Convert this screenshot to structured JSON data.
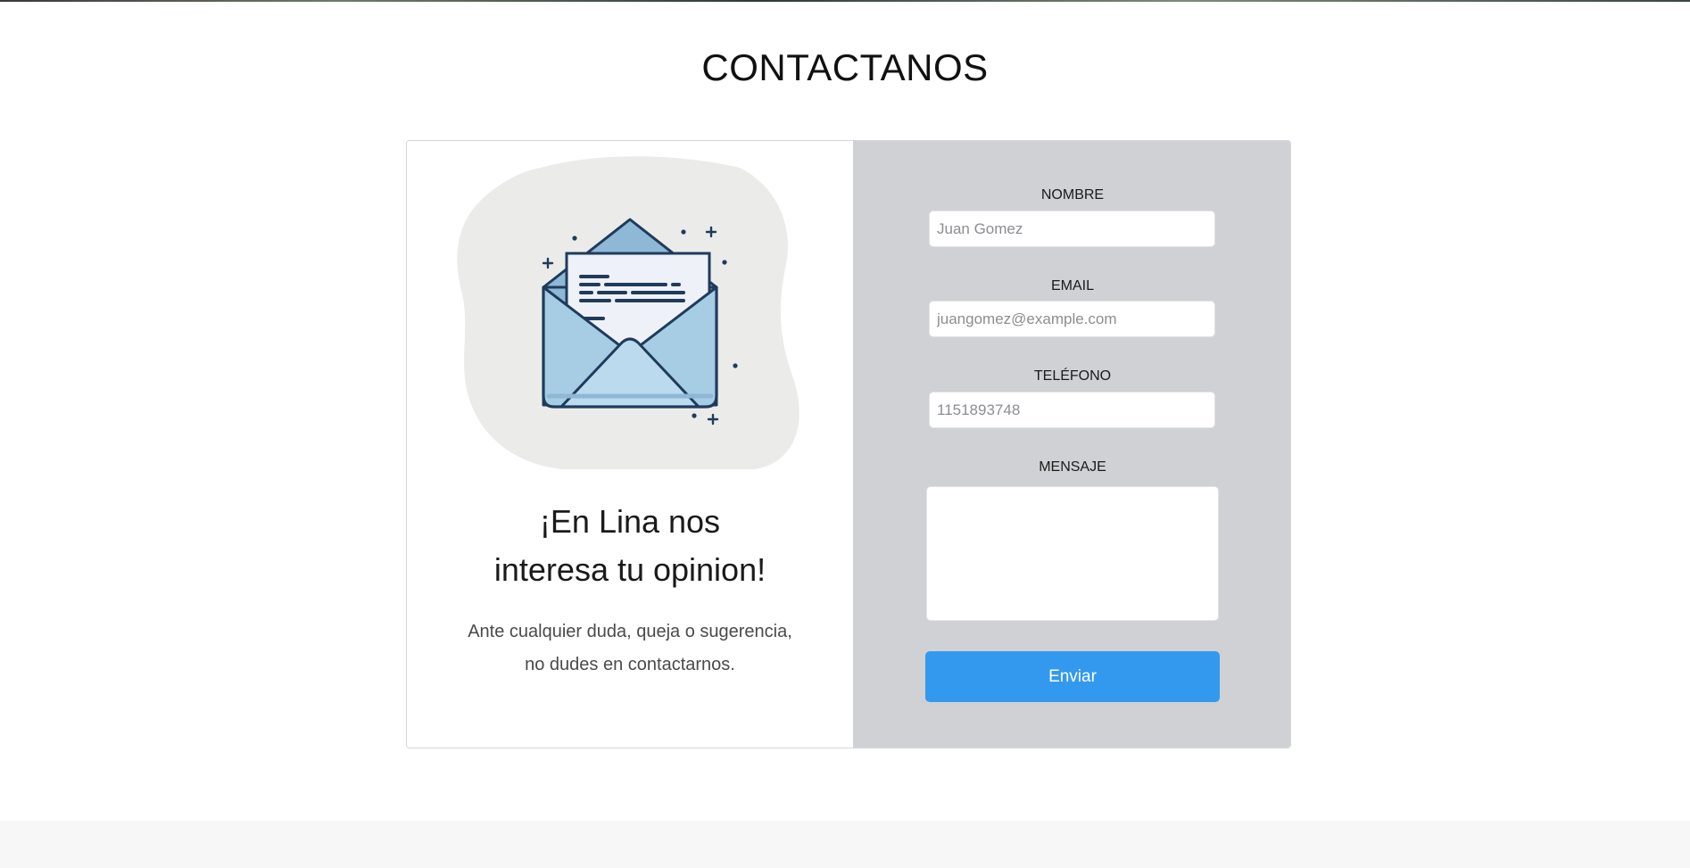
{
  "section": {
    "title": "CONTACTANOS"
  },
  "intro": {
    "heading_line1": "¡En Lina nos",
    "heading_line2": "interesa tu opinion!",
    "text_line1": "Ante cualquier duda, queja o sugerencia,",
    "text_line2": "no dudes en contactarnos."
  },
  "form": {
    "name_label": "NOMBRE",
    "name_placeholder": "Juan Gomez",
    "email_label": "EMAIL",
    "email_placeholder": "juangomez@example.com",
    "phone_label": "TELÉFONO",
    "phone_placeholder": "1151893748",
    "message_label": "MENSAJE",
    "message_placeholder": "",
    "submit_label": "Enviar"
  },
  "colors": {
    "accent": "#3399ee",
    "form_panel": "#d0d1d5",
    "illustration_blob": "#ebecea",
    "envelope_fill": "#a7cde5",
    "envelope_stroke": "#1f3b5c"
  },
  "icons": {
    "illustration": "open-envelope-with-letter-icon"
  }
}
